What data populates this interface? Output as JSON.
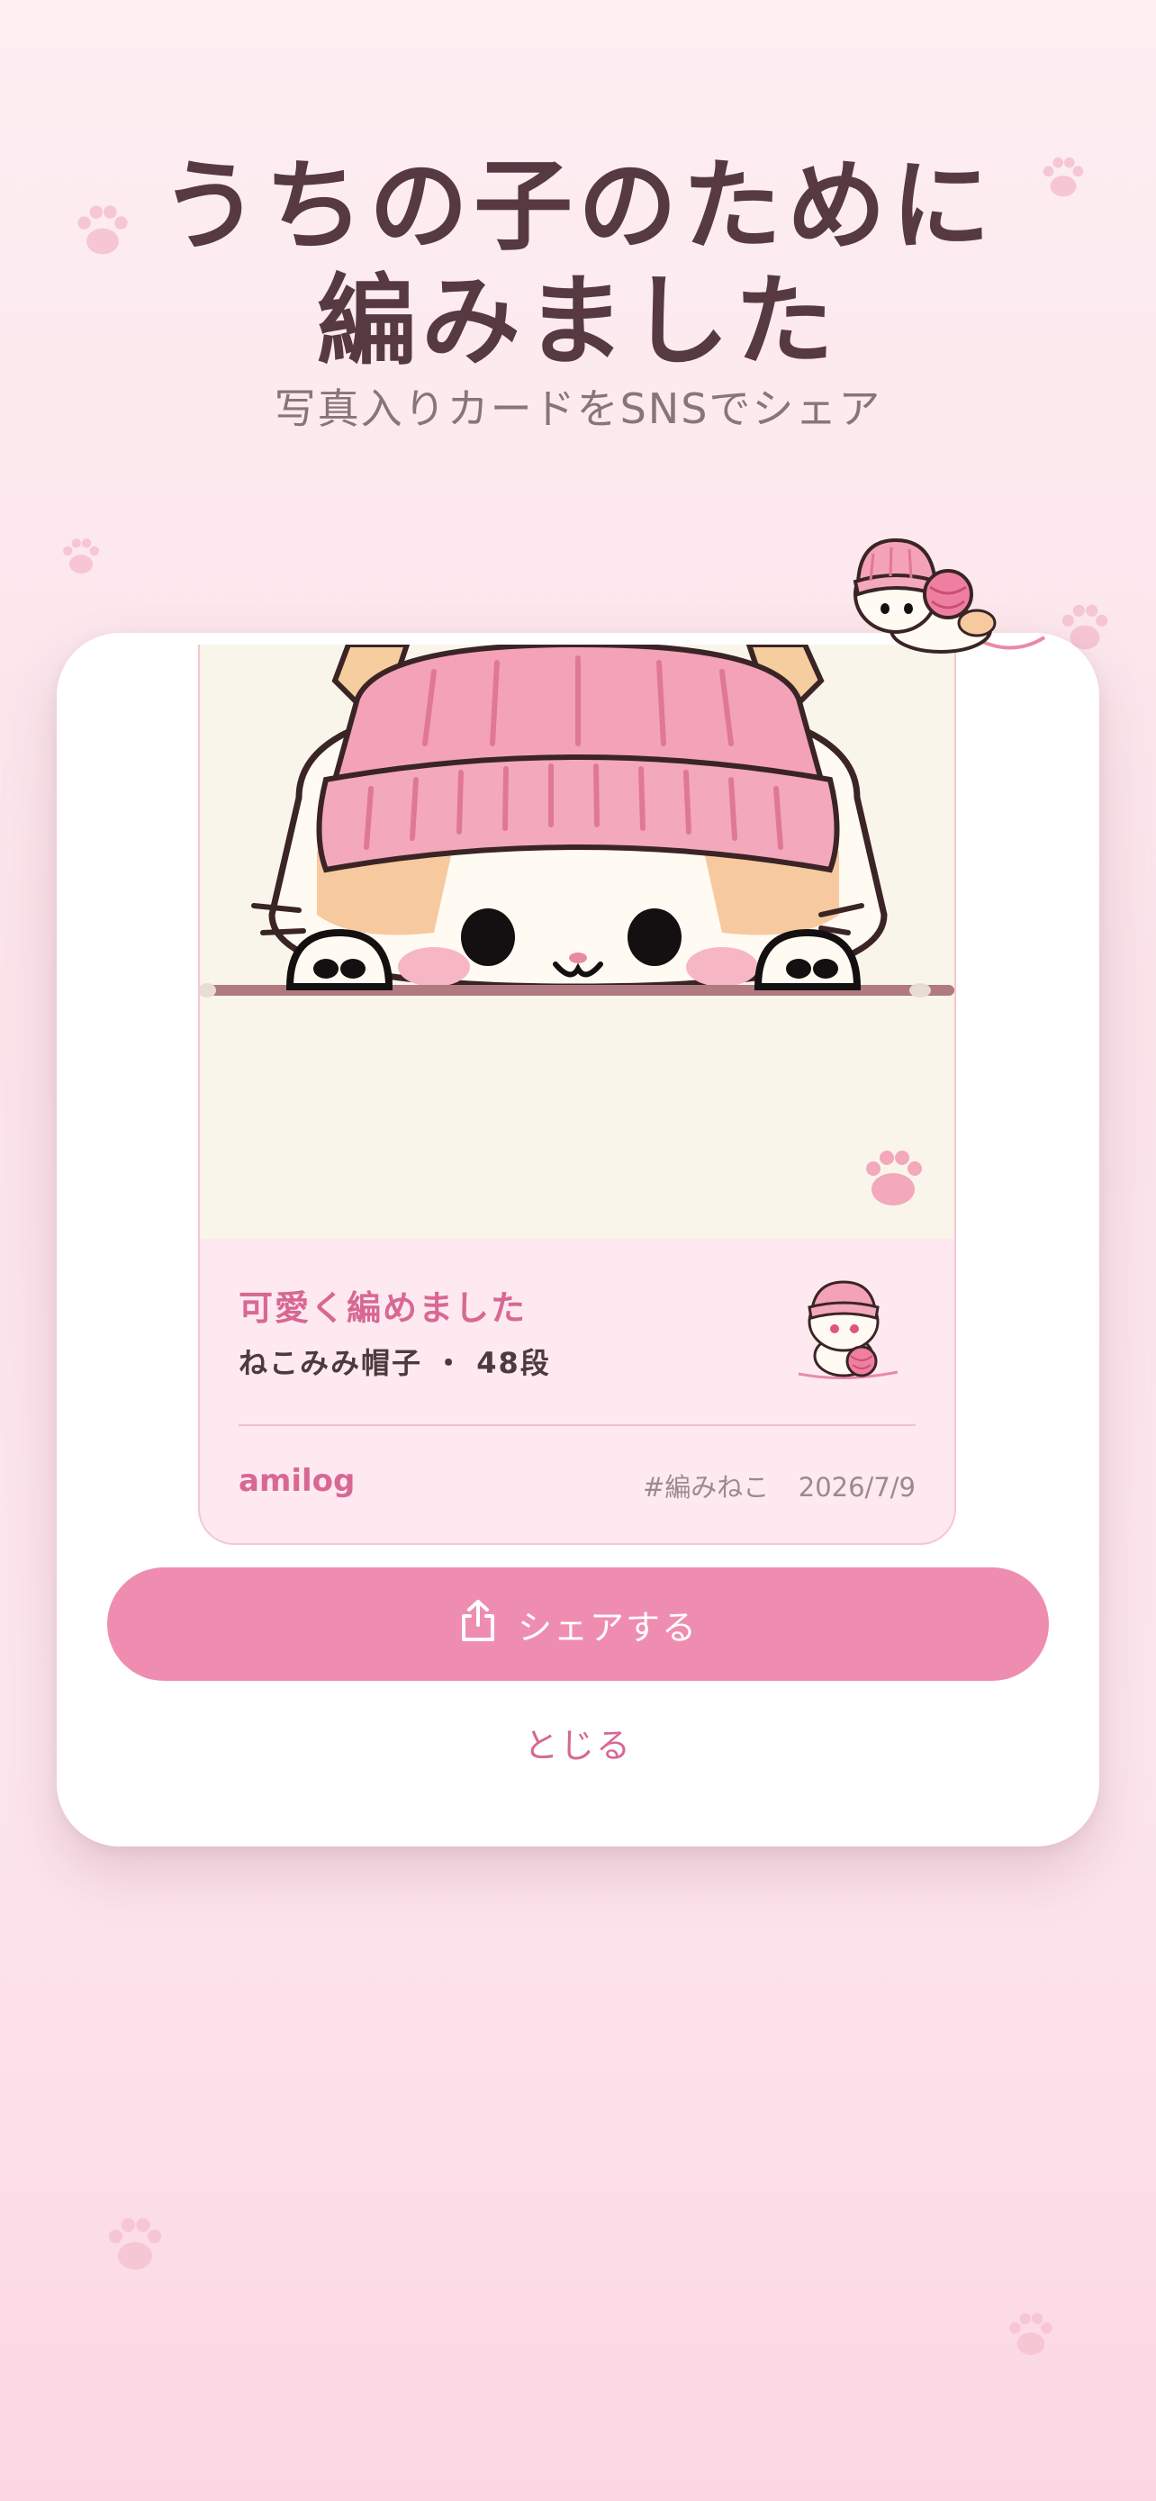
{
  "header": {
    "title_line1": "うちの子のために",
    "title_line2": "編みました",
    "subtitle": "写真入りカードをSNSでシェア"
  },
  "card": {
    "caption": "可愛く編めました",
    "project": "ねこみみ帽子 ・ 48段",
    "app_name": "amilog",
    "hashtag": "#編みねこ",
    "date": "2026/7/9"
  },
  "actions": {
    "share_label": "シェアする",
    "close_label": "とじる"
  },
  "icons": {
    "share": "share-icon",
    "paw": "paw-print-icon",
    "mascot": "knitting-cat-mascot"
  },
  "colors": {
    "accent": "#ef8db0",
    "accent_text": "#d86893",
    "title": "#573a41",
    "background": "#fdeef2"
  }
}
